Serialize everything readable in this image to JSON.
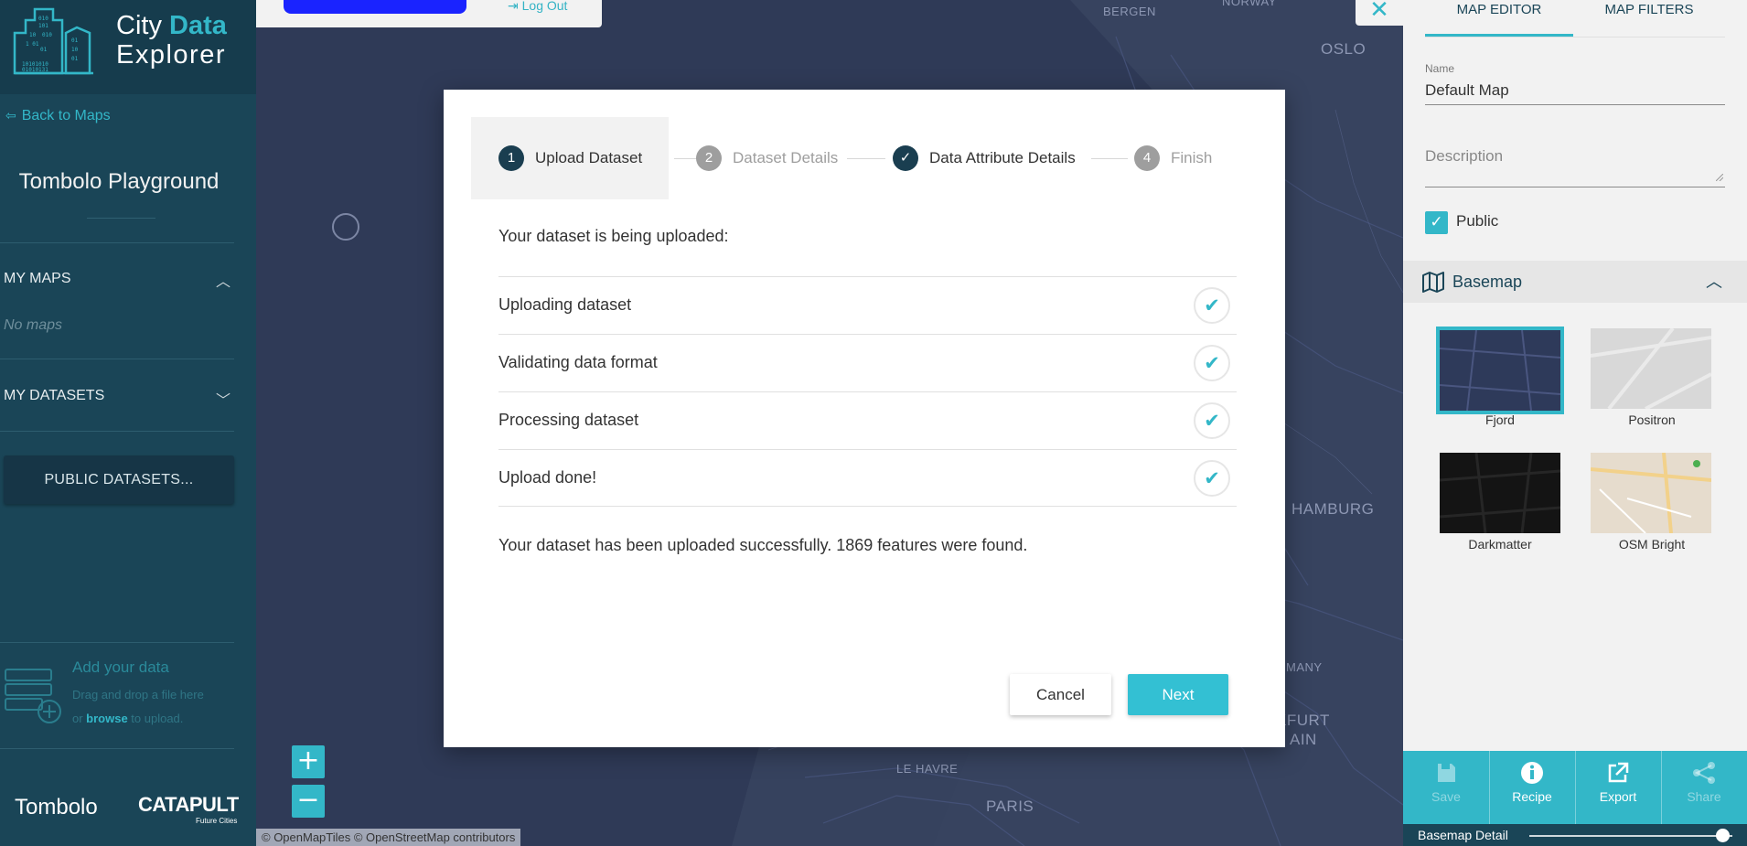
{
  "user_bar": {
    "logout_label": "Log Out"
  },
  "map": {
    "labels": {
      "bergen": "BERGEN",
      "norway": "NORWAY",
      "oslo": "OSLO",
      "hamburg": "HAMBURG",
      "many": "MANY",
      "kfurt": "KFURT",
      "ain": "AIN",
      "lehavre": "LE HAVRE",
      "paris": "PARIS"
    },
    "zoom_in": "+",
    "zoom_out": "−",
    "attribution": "© OpenMapTiles © OpenStreetMap contributors"
  },
  "sidebar": {
    "logo": {
      "line1_a": "City ",
      "line1_b": "Data",
      "line2": "Explorer"
    },
    "back_link": "Back to Maps",
    "project_title": "Tombolo Playground",
    "my_maps": "MY MAPS",
    "no_maps": "No maps",
    "my_datasets": "MY DATASETS",
    "public_datasets": "PUBLIC DATASETS...",
    "add_data": {
      "title": "Add your data",
      "line1": "Drag and drop a file here",
      "or": "or ",
      "browse": "browse",
      "rest": " to upload."
    },
    "footer": {
      "tombolo": "Tombolo",
      "catapult": "CATAPULT",
      "catapult_sub": "Future Cities"
    }
  },
  "modal": {
    "steps": [
      {
        "num": "1",
        "label": "Upload Dataset",
        "state": "active"
      },
      {
        "num": "2",
        "label": "Dataset Details",
        "state": "todo"
      },
      {
        "num": "✓",
        "label": "Data Attribute Details",
        "state": "done"
      },
      {
        "num": "4",
        "label": "Finish",
        "state": "todo"
      }
    ],
    "lead": "Your dataset is being uploaded:",
    "tasks": [
      {
        "label": "Uploading dataset",
        "done": true
      },
      {
        "label": "Validating data format",
        "done": true
      },
      {
        "label": "Processing dataset",
        "done": true
      },
      {
        "label": "Upload done!",
        "done": true
      }
    ],
    "result": "Your dataset has been uploaded successfully. 1869 features were found.",
    "cancel_label": "Cancel",
    "next_label": "Next"
  },
  "right_panel": {
    "close": "✕",
    "tabs": [
      "MAP EDITOR",
      "MAP FILTERS"
    ],
    "name_label": "Name",
    "name_value": "Default Map",
    "description_placeholder": "Description",
    "public_label": "Public",
    "public_checked": true,
    "basemap_title": "Basemap",
    "basemaps": [
      {
        "name": "Fjord",
        "selected": true
      },
      {
        "name": "Positron",
        "selected": false
      },
      {
        "name": "Darkmatter",
        "selected": false
      },
      {
        "name": "OSM Bright",
        "selected": false
      }
    ],
    "toolbar": [
      {
        "label": "Save",
        "icon": "save-icon",
        "enabled": false
      },
      {
        "label": "Recipe",
        "icon": "info-icon",
        "enabled": true
      },
      {
        "label": "Export",
        "icon": "external-link-icon",
        "enabled": true
      },
      {
        "label": "Share",
        "icon": "share-icon",
        "enabled": false
      }
    ],
    "basemap_detail_label": "Basemap Detail",
    "basemap_detail_value": 0.95
  },
  "colors": {
    "accent": "#33b7c8",
    "sidebar": "#1a4557",
    "step_dark": "#1a3e50"
  }
}
